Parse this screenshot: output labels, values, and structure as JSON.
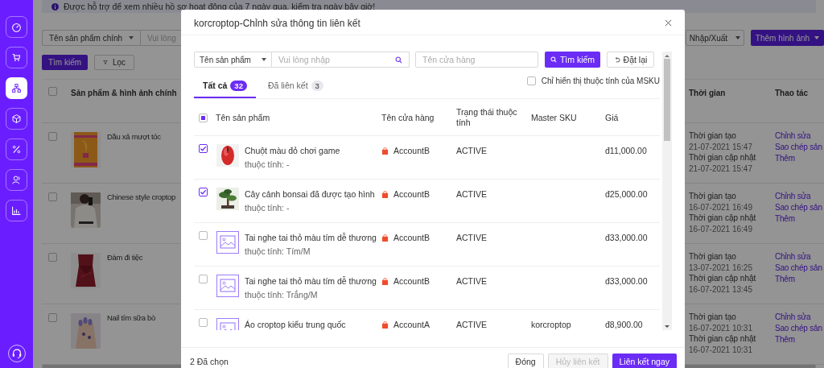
{
  "sidebar": {
    "items": [
      {
        "selected": false
      },
      {
        "selected": false
      },
      {
        "selected": true
      },
      {
        "selected": false
      },
      {
        "selected": false
      },
      {
        "selected": false
      },
      {
        "selected": false
      }
    ]
  },
  "notice": {
    "text": "Được hỗ trợ để xem nhiều hồ sơ hoạt động của 7 ngày qua, kiểm tra ngày bây giờ!"
  },
  "toolbar": {
    "field_select": "Tên sản phẩm chính",
    "search_placeholder": "Vui lòng",
    "search_button": "Tìm kiếm",
    "filter_button": "Lọc",
    "import_export": "Nhập/Xuất",
    "add_images": "Thêm hình ảnh"
  },
  "products": {
    "select_all": {
      "checked": false
    },
    "columns": [
      "Sản phẩm & hình ảnh chính",
      "Thời gian",
      "Thao tác"
    ],
    "rows": [
      {
        "checked": false,
        "name": "Dầu xả mượt tóc",
        "created_label": "Thời gian tạo",
        "created": "21-07-2021 15:47",
        "updated_label": "Thời gian cập nhật",
        "updated": "21-07-2021 15:47",
        "actions": [
          "Chỉnh sửa",
          "Sao chép sản",
          "Thêm"
        ]
      },
      {
        "checked": false,
        "name": "Chinese style croptop",
        "created_label": "Thời gian tạo",
        "created": "16-07-2021 16:49",
        "updated_label": "Thời gian cập nhật",
        "updated": "16-07-2021 16:49",
        "actions": [
          "Chỉnh sửa",
          "Sao chép sản",
          "Thêm"
        ]
      },
      {
        "checked": false,
        "name": "Đàm đi tiệc",
        "created_label": "Thời gian tạo",
        "created": "13-07-2021 16:25",
        "updated_label": "Thời gian cập nhật",
        "updated": "16-07-2021 13:45",
        "actions": [
          "Chỉnh sửa",
          "Sao chép sản",
          "Thêm"
        ]
      },
      {
        "checked": false,
        "name": "Nail tím sữa bò",
        "created_label": "Thời gian tạo",
        "created": "16-07-2021 10:31",
        "updated_label": "Thời gian cập nhật",
        "updated": "16-07-2021 10:31",
        "actions": [
          "Chỉnh sửa",
          "Sao chép sản",
          "Thêm"
        ]
      }
    ]
  },
  "dialog": {
    "title": "korcroptop-Chỉnh sửa thông tin liên kết",
    "search": {
      "field_select": "Tên sản phẩm",
      "placeholder": "Vui lòng nhập",
      "store_placeholder": "Tên cửa hàng",
      "search_button": "Tìm kiếm",
      "reset_button": "Đặt lại"
    },
    "tabs": [
      {
        "label": "Tất cả",
        "count": "32",
        "selected": true
      },
      {
        "label": "Đã liên kết",
        "count": "3",
        "selected": false
      }
    ],
    "msku_filter": {
      "label": "Chỉ hiển thị thuộc tính của MSKU",
      "checked": false
    },
    "table": {
      "select_all": {
        "indeterminate": true
      },
      "columns": [
        "Tên sản phẩm",
        "Tên cửa hàng",
        "Trạng thái thuộc tính",
        "Master SKU",
        "Giá"
      ],
      "rows": [
        {
          "checked": true,
          "kind": "picture",
          "name": "Chuột màu đỏ chơi game",
          "attribute": "thuộc tính: -",
          "store": "AccountB",
          "status": "ACTIVE",
          "price": "đ11,000.00"
        },
        {
          "checked": true,
          "kind": "picture",
          "name": "Cây cảnh bonsai đã được tạo hình",
          "attribute": "thuộc tính: -",
          "store": "AccountB",
          "status": "ACTIVE",
          "price": "đ25,000.00"
        },
        {
          "checked": false,
          "kind": "placeholder",
          "name": "Tai nghe tai thỏ màu tím dễ thương",
          "attribute": "thuộc tính: Tím/M",
          "store": "AccountB",
          "status": "ACTIVE",
          "price": "đ33,000.00"
        },
        {
          "checked": false,
          "kind": "placeholder",
          "name": "Tai nghe tai thỏ màu tím dễ thương",
          "attribute": "thuộc tính: Trắng/M",
          "store": "AccountB",
          "status": "ACTIVE",
          "price": "đ33,000.00"
        },
        {
          "checked": false,
          "kind": "placeholder",
          "name": "Áo croptop kiểu trung quốc",
          "store": "AccountA",
          "status": "ACTIVE",
          "master_sku": "korcroptop",
          "price": "đ8,900.00"
        }
      ]
    },
    "footer": {
      "selected_count": "2 Đã chọn",
      "close_button": "Đóng",
      "unlink_button": {
        "label": "Hủy liên kết",
        "disabled": true
      },
      "link_button": "Liên kết ngay"
    }
  }
}
